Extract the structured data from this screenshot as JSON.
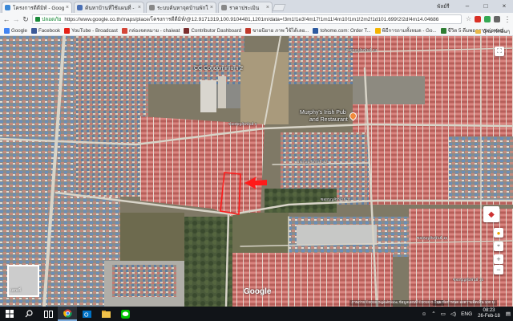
{
  "browser": {
    "tabs": [
      {
        "title": "โครงการดีดีมิท์ - Google M",
        "favicon_color": "#3a87d6",
        "active": true
      },
      {
        "title": "ค้นหาบ้านที่ใช้แผนที่ - ค้นหาบ้าน",
        "favicon_color": "#4a6fb5",
        "active": false
      },
      {
        "title": "ระบบค้นหาจุดบ้านพักใจ",
        "favicon_color": "#888888",
        "active": false
      },
      {
        "title": "ราคาประเมิน",
        "favicon_color": "#888888",
        "active": false
      }
    ],
    "user_label": "พัลย์รี",
    "secure_label": "ปลอดภัย",
    "url": "https://www.google.co.th/maps/place/โครงการดีดีมิท์/@12.9171319,100.9104481,1201m/data=!3m1!1e3!4m17!1m11!4m10!1m1!2m2!1d101.699!2!2d!4m14.04686",
    "bookmarks": [
      {
        "label": "Google",
        "icon_color": "#4285f4"
      },
      {
        "label": "Facebook",
        "icon_color": "#3b5998"
      },
      {
        "label": "YouTube - Broadcast",
        "icon_color": "#e62117"
      },
      {
        "label": "กล่องจดหมาย - chaiwat",
        "icon_color": "#d44638"
      },
      {
        "label": "Contributor Dashboard",
        "icon_color": "#7a2e2e"
      },
      {
        "label": "ขายนิยาย ภาพ ใช้ได้เลย...",
        "icon_color": "#c0392b"
      },
      {
        "label": "tohome.com: Order T...",
        "icon_color": "#2c5aa0"
      },
      {
        "label": "พิธีการถามทั้งหมด - Go...",
        "icon_color": "#f4b400"
      },
      {
        "label": "ชีวิต 5 ดีมพอตรานต่อพลบ...",
        "icon_color": "#2e7d32"
      }
    ],
    "other_bookmarks": "บุ๊กมาร์กอื่นๆ"
  },
  "map": {
    "labels": {
      "condo": "CC Condominium 2",
      "pub_line1": "Murphy's Irish Pub",
      "pub_line2": "and Restaurant",
      "google": "Google",
      "minimap": "แผนที่",
      "attribution": "ภาพถ่าย ©2018 DigitalGlobe,ข้อมูลแผนที่ ©2018 Google",
      "attribution_extra": "ไทย   ข้อกำหนด   ส่งความคิดเห็น   100 ม."
    },
    "roads": [
      "ซอยบุญสัมพันธ์ 24",
      "ซอยบุญสัมพันธ์ 9",
      "ซอยบุญสัมพันธ์ 12",
      "ซอยบุญสัมพันธ์ 11",
      "ซอยบุญสัมพันธ์ 15",
      "ซอยบุญสัมพันธ์ 13"
    ]
  },
  "taskbar": {
    "apps": [
      {
        "name": "chrome",
        "color": "#fbbc05"
      },
      {
        "name": "outlook",
        "color": "#0072c6"
      },
      {
        "name": "explorer",
        "color": "#f0c24a"
      },
      {
        "name": "line",
        "color": "#00c300"
      }
    ],
    "lang": "ENG",
    "time": "08:23",
    "date": "26-Feb-18"
  }
}
